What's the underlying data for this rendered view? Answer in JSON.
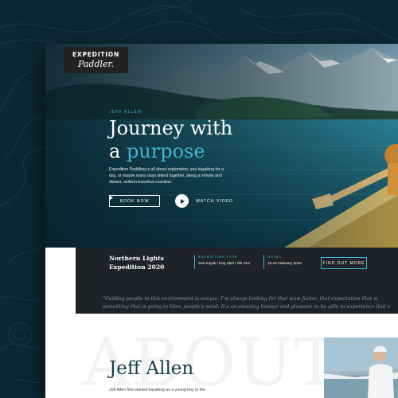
{
  "header": {
    "logo_line1": "EXPEDITION",
    "logo_line2": "Paddler."
  },
  "hero": {
    "eyebrow": "JEFF ALLEN",
    "headline_line1": "Journey with",
    "headline_a": "a ",
    "headline_accent": "purpose",
    "intro": "Expedition Paddling is all about exploration, sea kayaking for a day, or maybe many days linked together, along a remote and distant, seldom-travelled coastline.",
    "book_label": "BOOK NOW",
    "watch_label": "WATCH VIDEO"
  },
  "expedition": {
    "title": "Northern Lights Expedition 2020",
    "type_label": "EXPEDITION TYPE",
    "type_value": "Sea Kayak / Dog Sled / Ski Tour",
    "dates_label": "DATES",
    "dates_value": "16-24 February 2020",
    "cta_label": "FIND OUT MORE"
  },
  "quote": {
    "line1": "\"Guiding people in this environment is unique. I'm always looking for that wow factor, that expectation that w",
    "line2": "something that is going to blow people's mind. It's an amazing honour and pleasure to be able to experience that s"
  },
  "about": {
    "bg_word": "ABOUT",
    "name": "Jeff Allen",
    "text": "Jeff Allen first started kayaking as a young boy in the"
  },
  "colors": {
    "background": "#0c2833",
    "accent": "#3fb6d6",
    "dark_bar": "#1f2226",
    "heading": "#163f4c"
  }
}
